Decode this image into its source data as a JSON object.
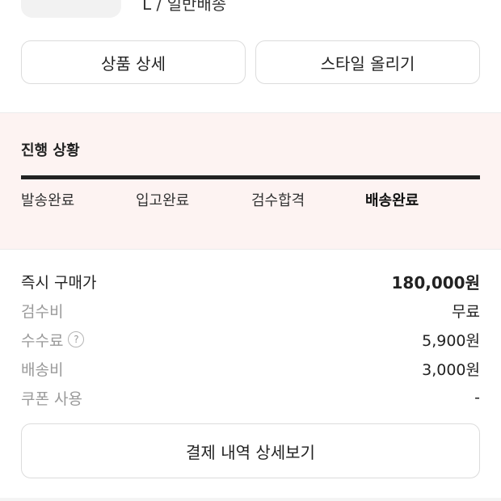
{
  "product": {
    "option_text": "L / 일반배송"
  },
  "actions": {
    "product_detail_label": "상품 상세",
    "post_style_label": "스타일 올리기"
  },
  "progress": {
    "title": "진행 상황",
    "steps": [
      "발송완료",
      "입고완료",
      "검수합격",
      "배송완료"
    ],
    "active_step": "배송완료",
    "completion": 1.0
  },
  "price": {
    "rows": [
      {
        "label": "즉시 구매가",
        "value": "180,000원"
      },
      {
        "label": "검수비",
        "value": "무료"
      },
      {
        "label": "수수료",
        "value": "5,900원",
        "help_icon": "question-circle-icon"
      },
      {
        "label": "배송비",
        "value": "3,000원"
      },
      {
        "label": "쿠폰 사용",
        "value": "-"
      }
    ]
  },
  "payment": {
    "detail_button_label": "결제 내역 상세보기"
  },
  "colors": {
    "progress_background": "#fdf3f2",
    "progress_fill": "#222222",
    "product_color": "#7a1423"
  }
}
